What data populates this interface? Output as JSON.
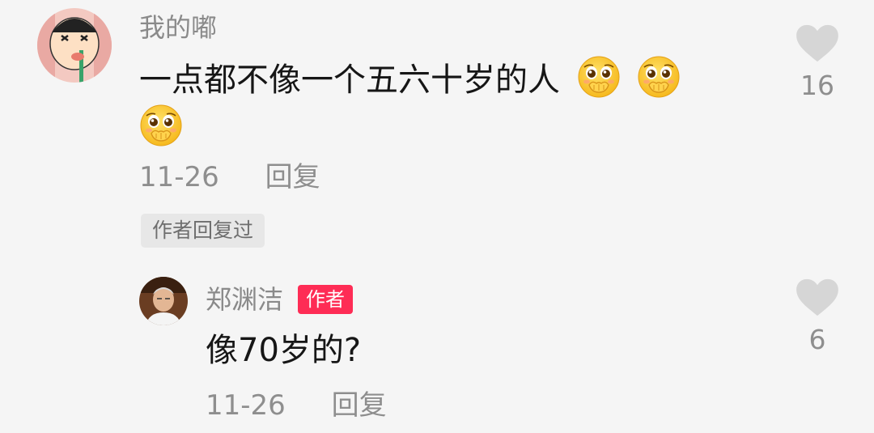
{
  "comment": {
    "username": "我的嘟",
    "text": "一点都不像一个五六十岁的人",
    "emojis": [
      "pleading-face-hands-over-mouth-emoji",
      "pleading-face-hands-over-mouth-emoji",
      "pleading-face-hands-over-mouth-emoji"
    ],
    "date": "11-26",
    "reply_label": "回复",
    "like_count": "16",
    "author_replied_label": "作者回复过"
  },
  "reply": {
    "username": "郑渊洁",
    "author_badge": "作者",
    "text": "像70岁的?",
    "date": "11-26",
    "reply_label": "回复",
    "like_count": "6"
  },
  "colors": {
    "background": "#f5f5f5",
    "secondary_text": "#8e8e8e",
    "primary_text": "#161616",
    "author_badge": "#fe2c55",
    "heart": "#d6d6d6"
  }
}
